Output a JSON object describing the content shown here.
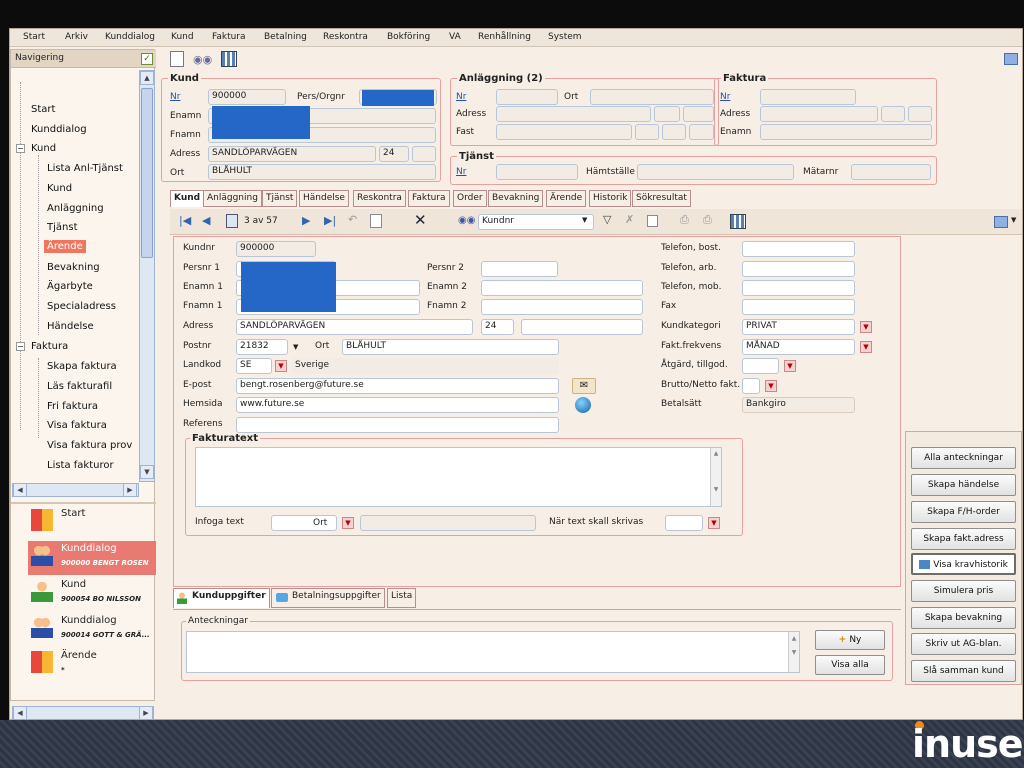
{
  "menu": [
    "Start",
    "Arkiv",
    "Kunddialog",
    "Kund",
    "Faktura",
    "Betalning",
    "Reskontra",
    "Bokföring",
    "VA",
    "Renhållning",
    "System"
  ],
  "nav": {
    "header": "Navigering",
    "tree": [
      "Start",
      "Kunddialog",
      "Kund",
      "Lista Anl-Tjänst",
      "Kund",
      "Anläggning",
      "Tjänst",
      "Ärende",
      "Bevakning",
      "Ägarbyte",
      "Specialadress",
      "Händelse",
      "Faktura",
      "Skapa faktura",
      "Läs fakturafil",
      "Fri faktura",
      "Visa faktura",
      "Visa faktura prov",
      "Lista fakturor"
    ],
    "history": [
      {
        "title": "Start",
        "sub": ""
      },
      {
        "title": "Kunddialog",
        "sub": "900000 BENGT ROSEN"
      },
      {
        "title": "Kund",
        "sub": "900054 BO NILSSON"
      },
      {
        "title": "Kunddialog",
        "sub": "900014 GOTT & GRÄ..."
      },
      {
        "title": "Ärende",
        "sub": "*"
      }
    ]
  },
  "kund": {
    "title": "Kund",
    "nr_label": "Nr",
    "nr": "900000",
    "persorgnr_label": "Pers/Orgnr",
    "enamn_label": "Enamn",
    "fnamn_label": "Fnamn",
    "adress_label": "Adress",
    "adress": "SANDLÖPARVÄGEN",
    "adress_no": "24",
    "ort_label": "Ort",
    "ort": "BLÅHULT"
  },
  "anl": {
    "title": "Anläggning (2)",
    "nr_label": "Nr",
    "ort_label": "Ort",
    "adress_label": "Adress",
    "fast_label": "Fast"
  },
  "faktura": {
    "title": "Faktura",
    "nr_label": "Nr",
    "adress_label": "Adress",
    "enamn_label": "Enamn"
  },
  "tjanst": {
    "title": "Tjänst",
    "nr_label": "Nr",
    "hamtstalle_label": "Hämtställe",
    "matarnr_label": "Mätarnr"
  },
  "tabs": [
    "Kund",
    "Anläggning",
    "Tjänst",
    "Händelse",
    "Reskontra",
    "Faktura",
    "Order",
    "Bevakning",
    "Ärende",
    "Historik",
    "Sökresultat"
  ],
  "toolbar": {
    "record": "3 av 57",
    "search_field": "Kundnr"
  },
  "form": {
    "kundnr_label": "Kundnr",
    "kundnr": "900000",
    "persnr1_label": "Persnr 1",
    "persnr2_label": "Persnr 2",
    "enamn1_label": "Enamn 1",
    "enamn2_label": "Enamn 2",
    "fnamn1_label": "Fnamn 1",
    "fnamn2_label": "Fnamn 2",
    "adress_label": "Adress",
    "adress": "SANDLÖPARVÄGEN",
    "adress_no": "24",
    "postnr_label": "Postnr",
    "postnr": "21832",
    "ort_label": "Ort",
    "ort": "BLÅHULT",
    "landkod_label": "Landkod",
    "landkod": "SE",
    "land": "Sverige",
    "epost_label": "E-post",
    "epost": "bengt.rosenberg@future.se",
    "hemsida_label": "Hemsida",
    "hemsida": "www.future.se",
    "referens_label": "Referens",
    "tel_bost_label": "Telefon, bost.",
    "tel_arb_label": "Telefon, arb.",
    "tel_mob_label": "Telefon, mob.",
    "fax_label": "Fax",
    "kundkat_label": "Kundkategori",
    "kundkat": "PRIVAT",
    "fakt_frek_label": "Fakt.frekvens",
    "fakt_frek": "MÅNAD",
    "atgard_label": "Åtgärd, tillgod.",
    "brutto_label": "Brutto/Netto fakt.",
    "betalsatt_label": "Betalsätt",
    "betalsatt": "Bankgiro",
    "fakturatext_title": "Fakturatext",
    "infoga_label": "Infoga text",
    "ort2_label": "Ort",
    "nar_label": "När text skall skrivas"
  },
  "subtabs": [
    "Kunduppgifter",
    "Betalningsuppgifter",
    "Lista"
  ],
  "anteckningar": {
    "title": "Anteckningar",
    "ny": "Ny",
    "visa_alla": "Visa alla"
  },
  "actions": [
    "Alla anteckningar",
    "Skapa händelse",
    "Skapa F/H-order",
    "Skapa fakt.adress",
    "Visa kravhistorik",
    "Simulera pris",
    "Skapa bevakning",
    "Skriv ut AG-blan.",
    "Slå samman kund"
  ],
  "brand": "inuse"
}
